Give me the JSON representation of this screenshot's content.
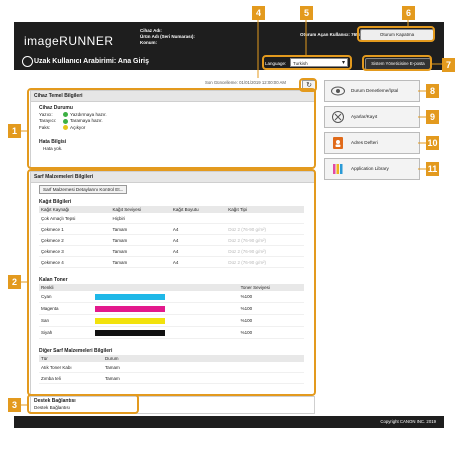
{
  "header": {
    "logo": "imageRUNNER",
    "device_name_label": "Cihaz Adı:",
    "product_label": "Ürün Adı (Seri Numarası):",
    "location_label": "Konum:",
    "device_name_value": "",
    "product_value": "",
    "user_label": "Oturum Açan Kullanıcı: 7654321",
    "logout_label": "Oturum Kapatma",
    "subtitle": "Uzak Kullanıcı Arabirimi: Ana Giriş",
    "language_label": "Language:",
    "language_value": "Turkish",
    "sysmon_label": "Sistem Yöneticisine E-posta"
  },
  "update": {
    "label": "Son Güncelleme: 01/01/2019 12:00:00 AM",
    "refresh_icon": "refresh-icon"
  },
  "basic": {
    "title": "Cihaz Temel Bilgileri",
    "status_heading": "Cihaz Durumu",
    "rows": [
      {
        "label": "Yazıcı:",
        "status": "Yazdırmaya hazır.",
        "color": "#3cb043"
      },
      {
        "label": "Tarayıcı:",
        "status": "Taramaya hazır.",
        "color": "#3cb043"
      },
      {
        "label": "Faks:",
        "status": "Açıkyor",
        "color": "#e6c619"
      }
    ],
    "error_heading": "Hata Bilgisi",
    "error_text": "Hata yok."
  },
  "consumables": {
    "title": "Sarf Malzemeleri Bilgileri",
    "check_button": "Sarf Malzemesi Detaylarını Kontrol Et...",
    "paper_heading": "Kağıt Bilgileri",
    "paper_columns": [
      "Kağıt Kaynağı",
      "Kağıt Seviyesi",
      "Kağıt Boyutu",
      "Kağıt Tipi"
    ],
    "paper_rows": [
      {
        "source": "Çok Amaçlı Tepsi",
        "level": "Hiçbiri",
        "size": "",
        "type": ""
      },
      {
        "source": "Çekmece 1",
        "level": "Tamam",
        "size": "A4",
        "type": "Düz 2 (76-90 g/m²)"
      },
      {
        "source": "Çekmece 2",
        "level": "Tamam",
        "size": "A4",
        "type": "Düz 2 (76-90 g/m²)"
      },
      {
        "source": "Çekmece 3",
        "level": "Tamam",
        "size": "A4",
        "type": "Düz 2 (76-90 g/m²)"
      },
      {
        "source": "Çekmece 4",
        "level": "Tamam",
        "size": "A4",
        "type": "Düz 2 (76-90 g/m²)"
      }
    ],
    "toner_heading": "Kalan Toner",
    "toner_columns": [
      "Renkli",
      "Toner Seviyesi"
    ],
    "toner_rows": [
      {
        "name": "Cyan",
        "color": "#1fb8e8",
        "level": "%100"
      },
      {
        "name": "Magenta",
        "color": "#e3198c",
        "level": "%100"
      },
      {
        "name": "Sarı",
        "color": "#f2e20c",
        "level": "%100"
      },
      {
        "name": "Siyah",
        "color": "#111111",
        "level": "%100"
      }
    ],
    "other_heading": "Diğer Sarf Malzemeleri Bilgileri",
    "other_columns": [
      "Tür",
      "Durum"
    ],
    "other_rows": [
      {
        "type": "Atık Toner Kabı",
        "status": "Tamam"
      },
      {
        "type": "Zımba teli",
        "status": "Tamam"
      }
    ]
  },
  "support": {
    "title": "Destek Bağlantısı",
    "link": "Destek Bağlantısı"
  },
  "menu": [
    {
      "label": "Durum Denetleme/İptal",
      "icon": "status-monitor-icon"
    },
    {
      "label": "Ayarlar/Kayıt",
      "icon": "settings-icon"
    },
    {
      "label": "Adres Defteri",
      "icon": "address-book-icon"
    },
    {
      "label": "Application Library",
      "icon": "application-library-icon"
    }
  ],
  "callouts": [
    "1",
    "2",
    "3",
    "4",
    "5",
    "6",
    "7",
    "8",
    "9",
    "10",
    "11"
  ],
  "footer": "Copyright CANON INC. 2019",
  "colors": {
    "accent": "#e39a1e",
    "header": "#1e1e1e"
  }
}
